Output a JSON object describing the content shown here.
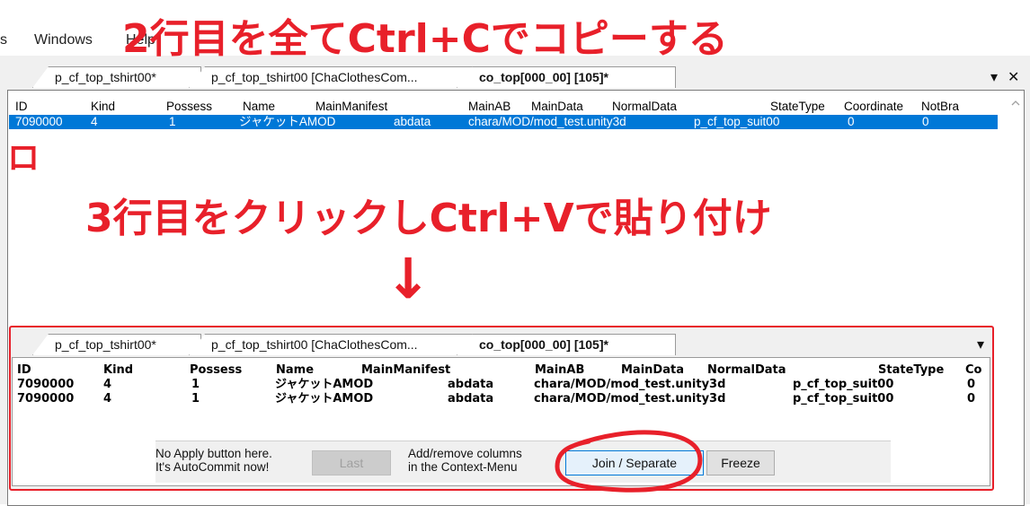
{
  "menubar": {
    "item_s": "s",
    "windows": "Windows",
    "help": "Help"
  },
  "annotations": {
    "title": "2行目を全てCtrl+Cでコピーする",
    "middle": "3行目をクリックしCtrl+Vで貼り付け",
    "arrow": "↓",
    "mark": "ロ",
    "accent_color": "#e8202a"
  },
  "top": {
    "tabs": [
      {
        "label": "p_cf_top_tshirt00*"
      },
      {
        "label": "p_cf_top_tshirt00 [ChaClothesCom..."
      },
      {
        "label": "co_top[000_00] [105]*"
      }
    ],
    "dropdown_icon": "▾",
    "close_icon": "✕",
    "columns": [
      "ID",
      "Kind",
      "Possess",
      "Name",
      "MainManifest",
      "MainAB",
      "MainData",
      "NormalData",
      "StateType",
      "Coordinate",
      "NotBra"
    ],
    "rows": [
      [
        "7090000",
        "4",
        "1",
        "ジャケットAMOD",
        "abdata",
        "chara/MOD/mod_test.unity3d",
        "p_cf_top_suit00",
        "0",
        "0"
      ]
    ],
    "selection_color": "#0078d7"
  },
  "bottom": {
    "tabs": [
      {
        "label": "p_cf_top_tshirt00*"
      },
      {
        "label": "p_cf_top_tshirt00 [ChaClothesCom..."
      },
      {
        "label": "co_top[000_00] [105]*"
      }
    ],
    "dropdown_icon": "▾",
    "columns": [
      "ID",
      "Kind",
      "Possess",
      "Name",
      "MainManifest",
      "MainAB",
      "MainData",
      "NormalData",
      "StateType",
      "Co"
    ],
    "rows": [
      [
        "7090000",
        "4",
        "1",
        "ジャケットAMOD",
        "abdata",
        "chara/MOD/mod_test.unity3d",
        "p_cf_top_suit00",
        "0"
      ],
      [
        "7090000",
        "4",
        "1",
        "ジャケットAMOD",
        "abdata",
        "chara/MOD/mod_test.unity3d",
        "p_cf_top_suit00",
        "0"
      ]
    ],
    "info_line1": "No Apply button here.",
    "info_line2": "It's AutoCommit now!",
    "last_button": "Last",
    "context_line1": "Add/remove columns",
    "context_line2": "in the Context-Menu",
    "join_button": "Join / Separate",
    "freeze_button": "Freeze"
  }
}
